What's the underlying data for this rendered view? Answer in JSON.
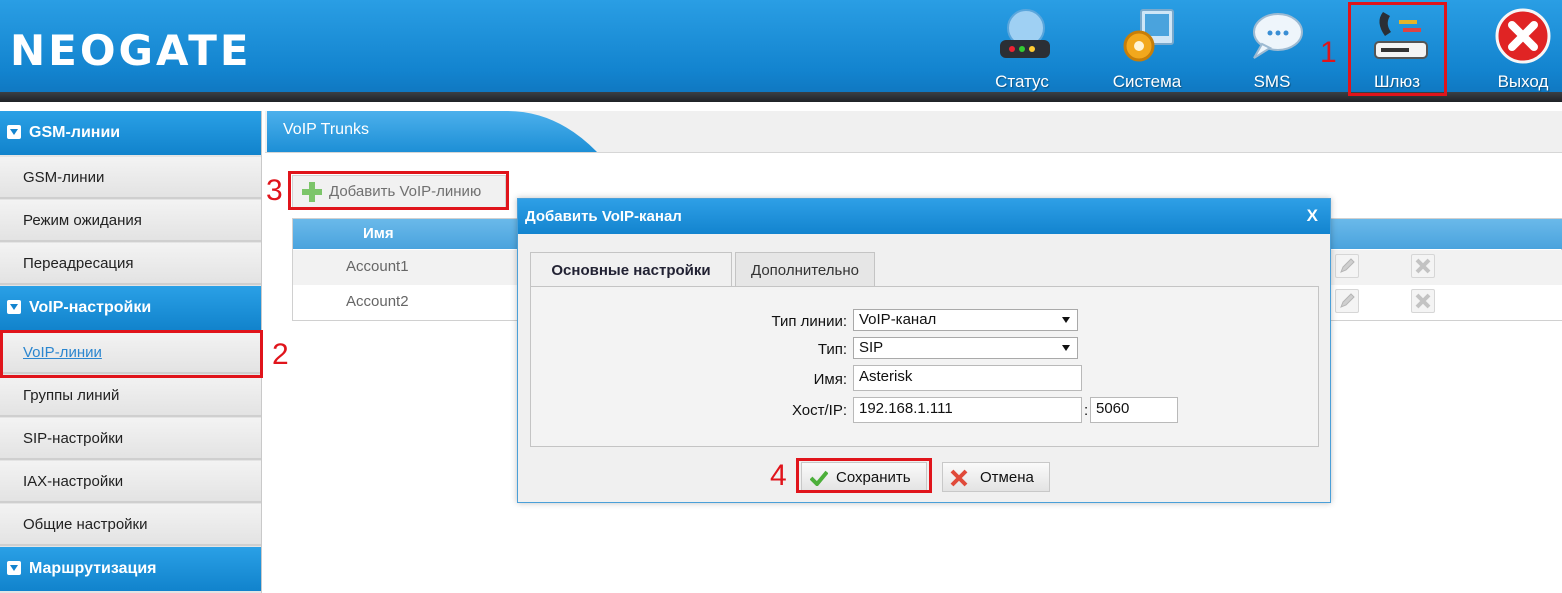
{
  "header": {
    "logo": "NEOGATE",
    "nav": [
      {
        "label": "Статус",
        "icon": "status-router-icon"
      },
      {
        "label": "Система",
        "icon": "system-gear-icon"
      },
      {
        "label": "SMS",
        "icon": "sms-bubble-icon"
      },
      {
        "label": "Шлюз",
        "icon": "gateway-phone-icon"
      },
      {
        "label": "Выход",
        "icon": "exit-close-icon"
      }
    ]
  },
  "annotations": {
    "n1": "1",
    "n2": "2",
    "n3": "3",
    "n4": "4"
  },
  "sidebar": {
    "sections": [
      {
        "title": "GSM-линии",
        "items": [
          "GSM-линии",
          "Режим ожидания",
          "Переадресация"
        ]
      },
      {
        "title": "VoIP-настройки",
        "items": [
          "VoIP-линии",
          "Группы линий",
          "SIP-настройки",
          "IAX-настройки",
          "Общие настройки"
        ]
      },
      {
        "title": "Маршрутизация",
        "items": []
      }
    ]
  },
  "main": {
    "tab_title": "VoIP Trunks",
    "add_button": "Добавить VoIP-линию",
    "table": {
      "header_name": "Имя",
      "rows": [
        {
          "name": "Account1"
        },
        {
          "name": "Account2"
        }
      ]
    }
  },
  "dialog": {
    "title": "Добавить VoIP-канал",
    "close": "X",
    "tabs": [
      "Основные настройки",
      "Дополнительно"
    ],
    "fields": {
      "line_type_label": "Тип линии:",
      "line_type_value": "VoIP-канал",
      "type_label": "Тип:",
      "type_value": "SIP",
      "name_label": "Имя:",
      "name_value": "Asterisk",
      "host_label": "Хост/IP:",
      "host_value": "192.168.1.111",
      "port_sep": ":",
      "port_value": "5060"
    },
    "save": "Сохранить",
    "cancel": "Отмена"
  },
  "colors": {
    "accent": "#1384cf",
    "annotation": "#e0141b"
  }
}
